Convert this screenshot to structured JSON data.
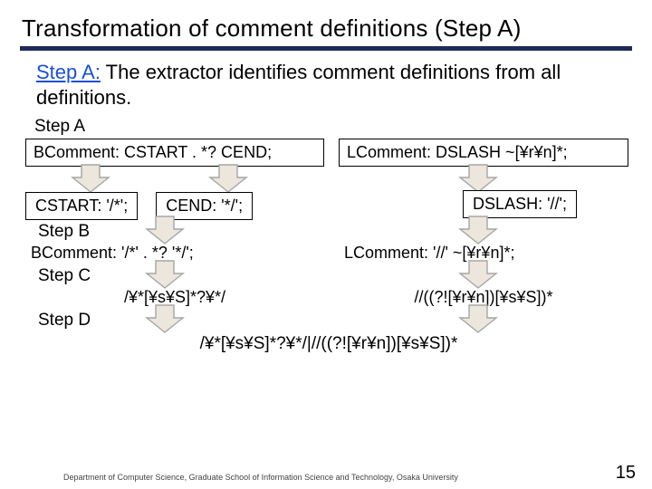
{
  "title": "Transformation of comment definitions (Step A)",
  "lead": {
    "link": "Step A:",
    "rest": " The extractor identifies comment definitions from all definitions."
  },
  "steps": {
    "A": "Step A",
    "B": "Step B",
    "C": "Step C",
    "D": "Step D"
  },
  "stepA": {
    "left": "BComment: CSTART . *? CEND;",
    "right": "LComment: DSLASH ~[¥r¥n]*;",
    "cstart": "CSTART: '/*';",
    "cend": "CEND: '*/';",
    "dslash": "DSLASH: '//';"
  },
  "stepB": {
    "left": "BComment: '/*' . *? '*/';",
    "right": "LComment: '//' ~[¥r¥n]*;"
  },
  "stepC": {
    "left": "/¥*[¥s¥S]*?¥*/",
    "right": "//((?![¥r¥n])[¥s¥S])*"
  },
  "stepD": {
    "combined": "/¥*[¥s¥S]*?¥*/|//((?![¥r¥n])[¥s¥S])*"
  },
  "footer": "Department of Computer Science, Graduate School of Information Science and Technology, Osaka University",
  "pageNum": "15",
  "colors": {
    "rule": "#1f2a5a",
    "arrowStroke": "#a6a6a6",
    "arrowFill": "#ece6dc"
  }
}
